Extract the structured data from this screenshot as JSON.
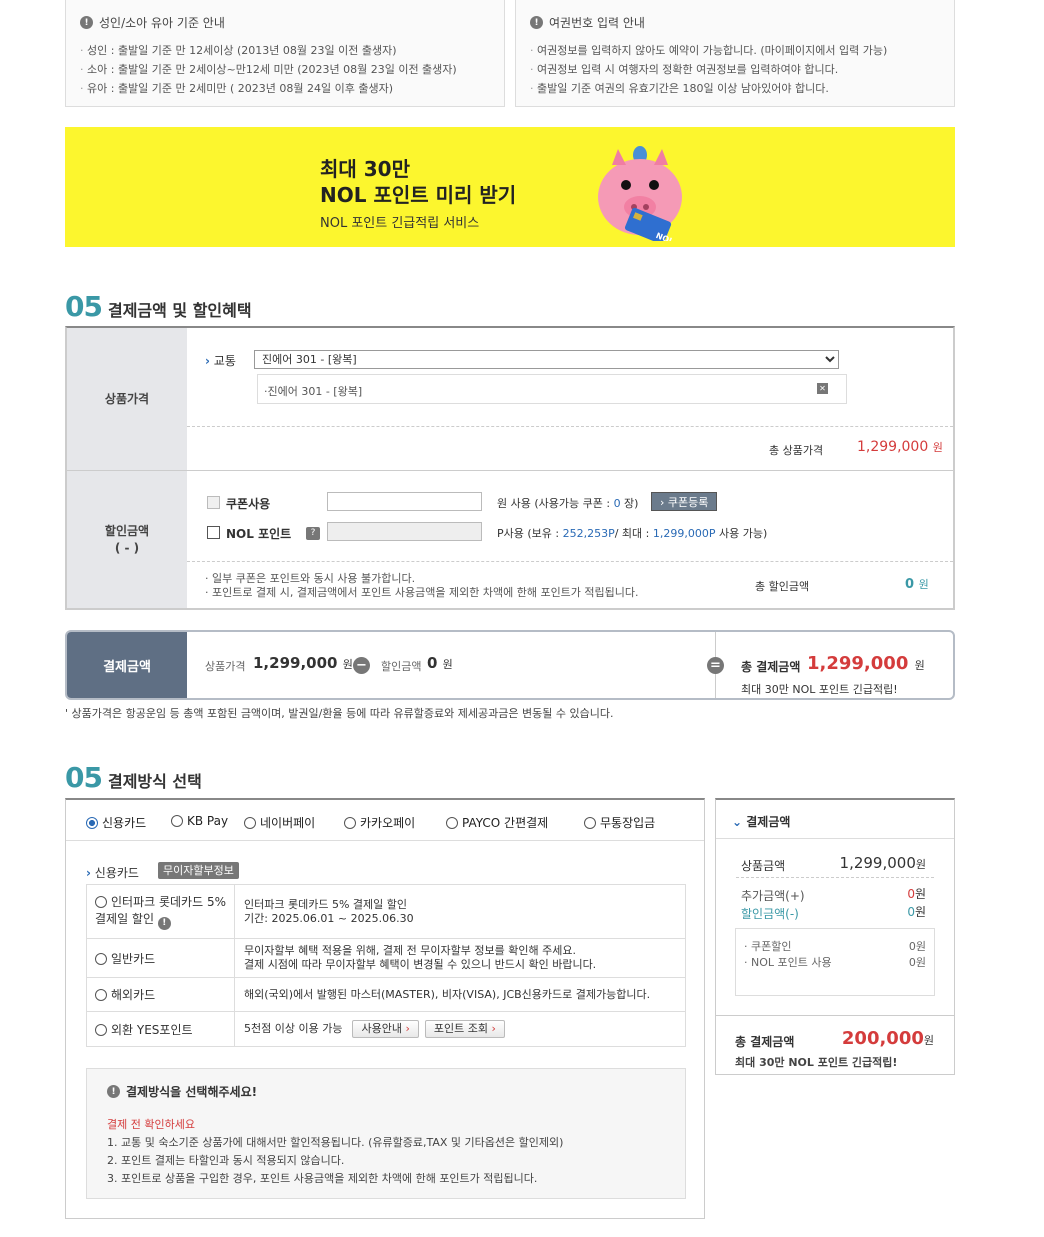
{
  "age_info": {
    "title": "성인/소아 유아 기준 안내",
    "lines": [
      "성인 : 출발일 기준 만 12세이상 (2013년 08월 23일 이전 출생자)",
      "소아 : 출발일 기준 만 2세이상~만12세 미만 (2023년 08월 23일 이전 출생자)",
      "유아 : 출발일 기준 만 2세미만 ( 2023년 08월 24일 이후 출생자)"
    ]
  },
  "passport_info": {
    "title": "여권번호 입력 안내",
    "lines": [
      "여권정보를 입력하지 않아도 예약이 가능합니다. (마이페이지에서 입력 가능)",
      "여권정보 입력 시 여행자의 정확한 여권정보를 입력하여야 합니다.",
      "출발일 기준 여권의 유효기간은 180일 이상 남아있어야 합니다."
    ]
  },
  "banner": {
    "line1": "최대 30만",
    "line2": "NOL 포인트 미리 받기",
    "line3": "NOL 포인트 긴급적립 서비스",
    "card_text": "NOL"
  },
  "section_price": {
    "num": "05",
    "title": "결제금액 및 할인혜택",
    "product_label": "상품가격",
    "transport_label": "교통",
    "transport_select": "진에어 301 - [왕복]",
    "transport_item": "·진에어 301 - [왕복]",
    "total_product_label": "총 상품가격",
    "total_product_value": "1,299,000",
    "won": "원",
    "discount_label": "할인금액",
    "discount_sub": "( - )",
    "coupon_label": "쿠폰사용",
    "coupon_suffix_a": "원 사용 (사용가능 쿠폰 : ",
    "coupon_count": "0",
    "coupon_suffix_b": " 장)",
    "coupon_btn": "› 쿠폰등록",
    "nol_label": "NOL 포인트",
    "nol_help": "?",
    "nol_suffix_a": "P사용 (보유 : ",
    "nol_have": "252,253P",
    "nol_suffix_b": "/ 최대 : ",
    "nol_max": "1,299,000P",
    "nol_suffix_c": " 사용 가능)",
    "notes": [
      "일부 쿠폰은 포인트와 동시 사용 불가합니다.",
      "포인트로 결제 시, 결제금액에서 포인트 사용금액을 제외한 차액에 한해 포인트가 적립됩니다."
    ],
    "total_discount_label": "총 할인금액",
    "total_discount_value": "0"
  },
  "pay_bar": {
    "label": "결제금액",
    "product_label": "상품가격",
    "product_value": "1,299,000",
    "won": "원",
    "minus": "−",
    "discount_label": "할인금액",
    "discount_value": "0",
    "equals": "=",
    "total_label": "총 결제금액",
    "total_value": "1,299,000",
    "sub": "최대 30만 NOL 포인트 긴급적립!",
    "footnote": "상품가격은 항공운임 등 총액 포함된 금액이며, 발권일/환율 등에 따라 유류할증료와 제세공과금은 변동될 수 있습니다."
  },
  "section_method": {
    "num": "05",
    "title": "결제방식 선택",
    "tabs": [
      "신용카드",
      "KB Pay",
      "네이버페이",
      "카카오페이",
      "PAYCO 간편결제",
      "무통장입금"
    ],
    "credit_label": "신용카드",
    "installment_btn": "무이자할부정보",
    "rows": [
      {
        "name": "인터파크 롯데카드 5% 결제일 할인",
        "desc1": "인터파크 롯데카드 5% 결제일 할인",
        "desc2": "기간: 2025.06.01 ~ 2025.06.30"
      },
      {
        "name": "일반카드",
        "desc1": "무이자할부 혜택 적용을 위해, 결제 전 무이자할부 정보를 확인해 주세요.",
        "desc2": "결제 시점에 따라 무이자할부 혜택이 변경될 수 있으니 반드시 확인 바랍니다."
      },
      {
        "name": "해외카드",
        "desc1": "해외(국외)에서 발행된 마스터(MASTER), 비자(VISA), JCB신용카드로 결제가능합니다.",
        "desc2": ""
      },
      {
        "name": "외환 YES포인트",
        "desc1": "5천점 이상 이용 가능",
        "btn1": "사용안내",
        "btn2": "포인트 조회"
      }
    ],
    "note_title": "결제방식을 선택해주세요!",
    "note_red": "결제 전 확인하세요",
    "note_lines": [
      "1. 교통 및 숙소기준 상품가에 대해서만 할인적용됩니다. (유류할증료,TAX 및 기타옵션은 할인제외)",
      "2. 포인트 결제는 타할인과 동시 적용되지 않습니다.",
      "3. 포인트로 상품을 구입한 경우, 포인트 사용금액을 제외한 차액에 한해 포인트가 적립됩니다."
    ]
  },
  "summary": {
    "title": "결제금액",
    "product_label": "상품금액",
    "product_value": "1,299,000",
    "won": "원",
    "extra_label": "추가금액(+)",
    "extra_value": "0",
    "discount_label": "할인금액(-)",
    "discount_value": "0",
    "coupon_label": "쿠폰할인",
    "coupon_value": "0원",
    "nol_label": "NOL 포인트 사용",
    "nol_value": "0원",
    "total_label": "총 결제금액",
    "total_value": "200,000",
    "sub": "최대 30만 NOL 포인트 긴급적립!"
  },
  "colors": {
    "accent": "#3a98a6",
    "red": "#d43c3c",
    "banner": "#fcf62e",
    "label_bg": "#e6e7ea",
    "pay_label_bg": "#5f6f84"
  }
}
